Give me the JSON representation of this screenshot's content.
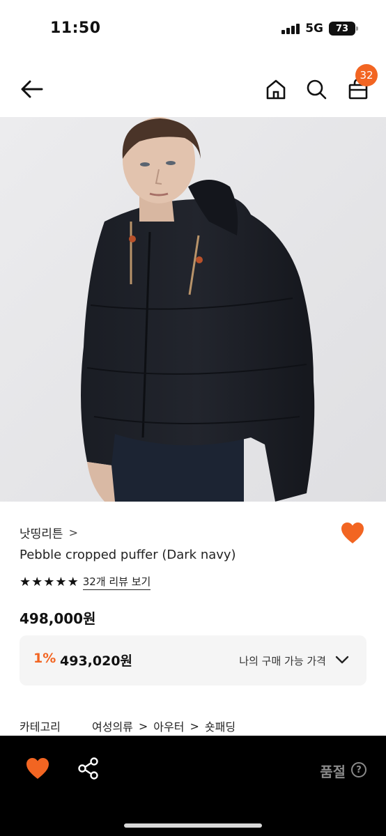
{
  "status": {
    "time": "11:50",
    "network": "5G",
    "battery": "73"
  },
  "nav": {
    "cart_count": "32"
  },
  "product": {
    "brand": "낫띵리튼",
    "brand_chevron": ">",
    "name": "Pebble cropped puffer (Dark navy)",
    "rating_stars": 5,
    "review_link": "32개 리뷰 보기",
    "price": "498,000원",
    "discount": "1%",
    "my_price": "493,020원",
    "my_price_label": "나의 구매 가능 가격",
    "category_label": "카테고리",
    "category_path": [
      "여성의류",
      "아우터",
      "숏패딩"
    ],
    "liked": true
  },
  "bottom": {
    "status": "품절",
    "help": "?"
  },
  "colors": {
    "accent": "#f26522",
    "heart": "#f26522",
    "bar_bg": "#000000",
    "soldout_text": "#8a8a8a"
  },
  "icons": [
    "back-arrow-icon",
    "home-icon",
    "search-icon",
    "shopping-bag-icon",
    "heart-icon",
    "star-icon",
    "chevron-down-icon",
    "share-icon",
    "help-icon"
  ]
}
